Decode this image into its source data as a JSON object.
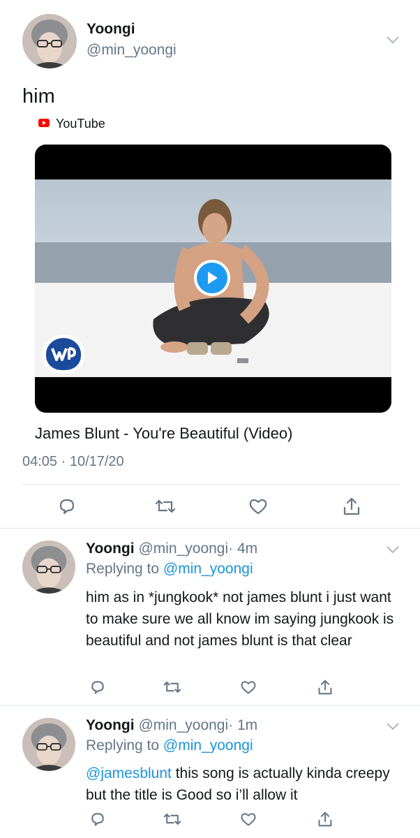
{
  "main_tweet": {
    "display_name": "Yoongi",
    "handle": "@min_yoongi",
    "text": "him",
    "link_source": "YouTube",
    "card_title": "James Blunt - You're Beautiful (Video)",
    "timestamp": "04:05 · 10/17/20",
    "icons": [
      "reply-icon",
      "retweet-icon",
      "like-icon",
      "share-icon",
      "chevron-down-icon",
      "youtube-icon",
      "play-icon",
      "warner-logo"
    ]
  },
  "replies": [
    {
      "display_name": "Yoongi",
      "handle": "@min_yoongi",
      "age": "· 4m",
      "replying_label": "Replying to",
      "replying_to": "@min_yoongi",
      "text": "him as in *jungkook* not james blunt i just want to make sure we all know im saying jungkook is beautiful and not james blunt is that clear"
    },
    {
      "display_name": "Yoongi",
      "handle": "@min_yoongi",
      "age": "· 1m",
      "replying_label": "Replying to",
      "replying_to": "@min_yoongi",
      "mention": "@jamesblunt",
      "text": " this song is actually kinda creepy but the title is Good so i’ll allow it"
    }
  ],
  "colors": {
    "link": "#1b95e0",
    "secondary_text": "#657786",
    "divider": "#e1e8ed",
    "youtube_red": "#ff0000",
    "play_button": "#1d9bf0"
  }
}
